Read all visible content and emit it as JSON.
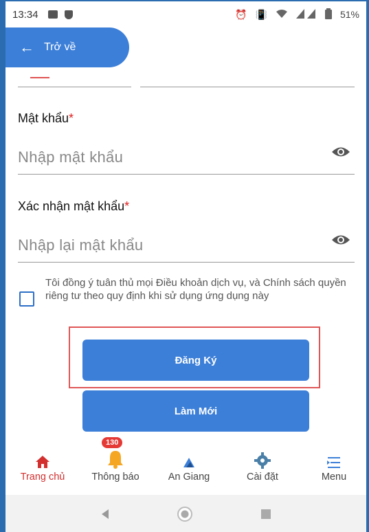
{
  "status_bar": {
    "time": "13:34",
    "right_icons": [
      "alarm-icon",
      "vibrate-icon",
      "wifi-icon",
      "signal-icon",
      "battery-icon"
    ],
    "battery": "51%"
  },
  "header": {
    "back_label": "Trở về"
  },
  "form": {
    "password_label": "Mật khẩu",
    "password_placeholder": "Nhập mật khẩu",
    "confirm_label": "Xác nhận mật khẩu",
    "confirm_placeholder": "Nhập lại mật khẩu",
    "required_mark": "*",
    "agree_text": "Tôi đồng ý tuân thủ mọi Điều khoản dịch vụ, và Chính sách quyền riêng tư theo quy định khi sử dụng ứng dụng này",
    "agree_checked": false
  },
  "buttons": {
    "register_label": "Đăng Ký",
    "refresh_label": "Làm Mới"
  },
  "bottom_nav": {
    "items": [
      {
        "label": "Trang chủ",
        "icon": "home-icon",
        "active": true
      },
      {
        "label": "Thông báo",
        "icon": "bell-icon",
        "badge": "130"
      },
      {
        "label": "An Giang",
        "icon": "logo-icon"
      },
      {
        "label": "Cài đặt",
        "icon": "gear-icon"
      },
      {
        "label": "Menu",
        "icon": "menu-icon"
      }
    ]
  },
  "colors": {
    "primary": "#3c7fd8",
    "required": "#e02020",
    "active_nav": "#d32f2f",
    "badge": "#e53935",
    "highlight_border": "#e05555"
  }
}
